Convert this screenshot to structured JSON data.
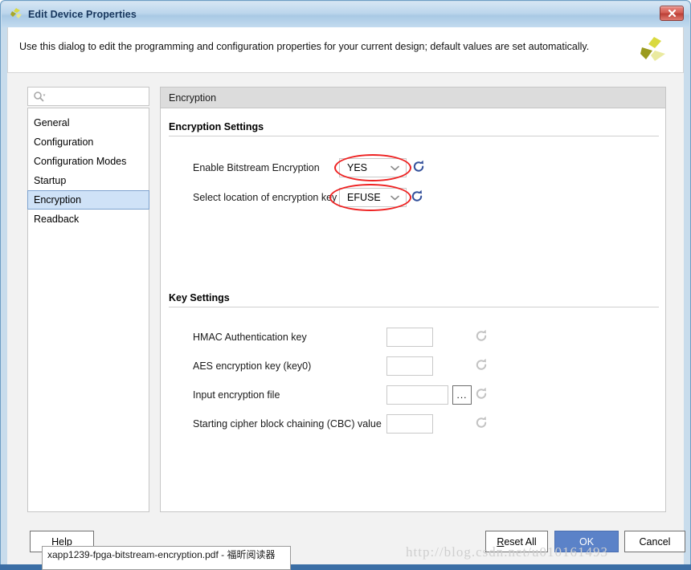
{
  "window": {
    "title": "Edit Device Properties",
    "icon": "xilinx-logo-icon",
    "close_label": "x",
    "description": "Use this dialog to edit the programming and configuration properties for your current design; default values are set automatically."
  },
  "search": {
    "icon": "search-icon",
    "placeholder": "",
    "value": ""
  },
  "sidebar": {
    "items": [
      {
        "label": "General",
        "selected": false
      },
      {
        "label": "Configuration",
        "selected": false
      },
      {
        "label": "Configuration Modes",
        "selected": false
      },
      {
        "label": "Startup",
        "selected": false
      },
      {
        "label": "Encryption",
        "selected": true
      },
      {
        "label": "Readback",
        "selected": false
      }
    ]
  },
  "panel": {
    "header": "Encryption",
    "encryption_settings": {
      "title": "Encryption Settings",
      "rows": [
        {
          "label": "Enable Bitstream Encryption",
          "value": "YES",
          "control": "dropdown",
          "annotated": true
        },
        {
          "label": "Select location of encryption key",
          "value": "EFUSE",
          "control": "dropdown",
          "annotated": true
        }
      ]
    },
    "key_settings": {
      "title": "Key Settings",
      "rows": [
        {
          "label": "HMAC Authentication key",
          "value": "",
          "control": "text"
        },
        {
          "label": "AES encryption key (key0)",
          "value": "",
          "control": "text"
        },
        {
          "label": "Input encryption file",
          "value": "",
          "control": "text-browse",
          "browse_label": "..."
        },
        {
          "label": "Starting cipher block chaining (CBC) value",
          "value": "",
          "control": "text"
        }
      ]
    }
  },
  "footer": {
    "help_label": "Help",
    "reset_all_label": "Reset All",
    "ok_label": "OK",
    "cancel_label": "Cancel"
  },
  "taskbar_tooltip": {
    "text": "xapp1239-fpga-bitstream-encryption.pdf - 福昕阅读器"
  },
  "watermark": {
    "text": "http://blog.csdn.net/u010161493"
  },
  "colors": {
    "accent_blue": "#5b82c8",
    "selection_blue": "#cfe2f7",
    "annotation_red": "#ee2222",
    "refresh_active": "#34519b",
    "refresh_disabled": "#c3c3c3",
    "title_text": "#17365d"
  }
}
